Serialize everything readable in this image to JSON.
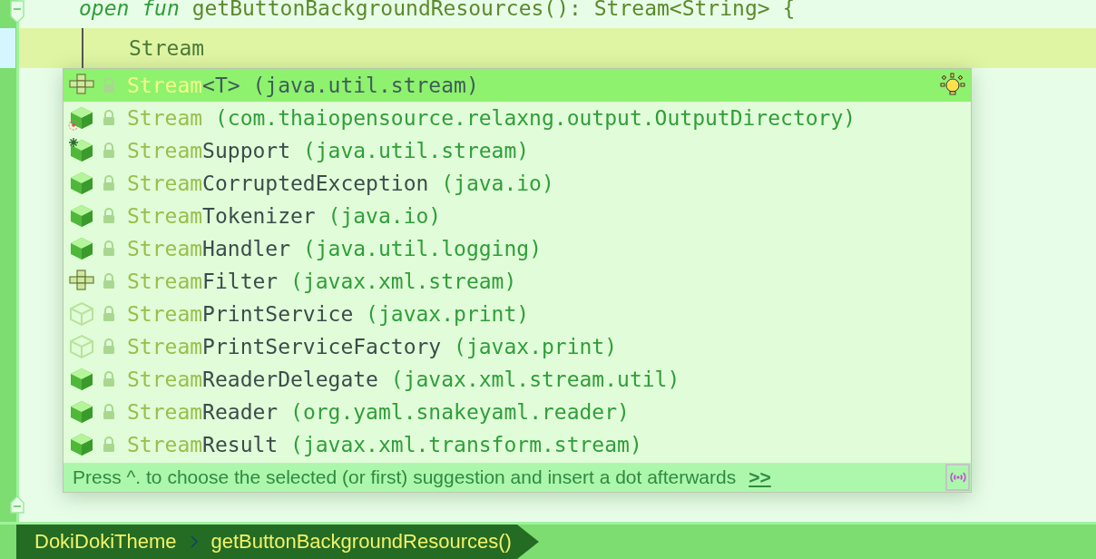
{
  "editor": {
    "lines": [
      {
        "keyword": "open fun",
        "code": " getButtonBackgroundResources(): Stream<String> {",
        "current": false
      },
      {
        "code": "Stream",
        "current": true
      }
    ]
  },
  "completion": {
    "items": [
      {
        "kind": "interface",
        "match": "Stream",
        "name": "<T>",
        "package": " (java.util.stream)",
        "selected": true
      },
      {
        "kind": "target",
        "match": "Stream",
        "package": " (com.thaiopensource.relaxng.output.OutputDirectory)",
        "selected": false
      },
      {
        "kind": "gear",
        "match": "Stream",
        "name": "Support",
        "package": " (java.util.stream)",
        "selected": false
      },
      {
        "kind": "class",
        "match": "Stream",
        "name": "CorruptedException",
        "package": " (java.io)",
        "selected": false
      },
      {
        "kind": "class",
        "match": "Stream",
        "name": "Tokenizer",
        "package": " (java.io)",
        "selected": false
      },
      {
        "kind": "class",
        "match": "Stream",
        "name": "Handler",
        "package": " (java.util.logging)",
        "selected": false
      },
      {
        "kind": "interface",
        "match": "Stream",
        "name": "Filter",
        "package": " (javax.xml.stream)",
        "selected": false
      },
      {
        "kind": "outline",
        "match": "Stream",
        "name": "PrintService",
        "package": " (javax.print)",
        "selected": false
      },
      {
        "kind": "outline",
        "match": "Stream",
        "name": "PrintServiceFactory",
        "package": " (javax.print)",
        "selected": false
      },
      {
        "kind": "class",
        "match": "Stream",
        "name": "ReaderDelegate",
        "package": " (javax.xml.stream.util)",
        "selected": false
      },
      {
        "kind": "class",
        "match": "Stream",
        "name": "Reader",
        "package": " (org.yaml.snakeyaml.reader)",
        "selected": false
      },
      {
        "kind": "class",
        "match": "Stream",
        "name": "Result",
        "package": " (javax.xml.transform.stream)",
        "selected": false
      }
    ],
    "hint": "Press ^. to choose the selected (or first) suggestion and insert a dot afterwards",
    "hint_link": ">>"
  },
  "breadcrumbs": [
    "DokiDokiTheme",
    "getButtonBackgroundResources()"
  ]
}
